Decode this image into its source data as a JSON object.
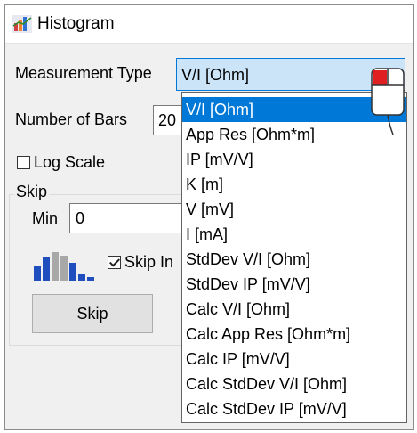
{
  "window": {
    "title": "Histogram",
    "icon": "histogram-app-icon"
  },
  "form": {
    "measurement_type_label": "Measurement Type",
    "measurement_type_value": "V/I [Ohm]",
    "number_of_bars_label": "Number of Bars",
    "number_of_bars_value": "20",
    "log_scale_label": "Log Scale",
    "log_scale_checked": false
  },
  "skip_group": {
    "legend": "Skip",
    "min_label": "Min",
    "min_value": "0",
    "skip_checkbox_label": "Skip In",
    "skip_checkbox_checked": true,
    "skip_button_label": "Skip"
  },
  "dropdown": {
    "selected_index": 0,
    "options": [
      "V/I [Ohm]",
      "App Res [Ohm*m]",
      "IP [mV/V]",
      "K [m]",
      "V [mV]",
      "I [mA]",
      "StdDev V/I [Ohm]",
      "StdDev IP [mV/V]",
      "Calc V/I [Ohm]",
      "Calc App Res [Ohm*m]",
      "Calc IP [mV/V]",
      "Calc StdDev V/I [Ohm]",
      "Calc StdDev IP [mV/V]"
    ]
  },
  "colors": {
    "accent": "#0078d7",
    "combo_bg": "#cce4f7",
    "window_bg": "#f0f0f0",
    "histogram_blue": "#1f4fbf",
    "histogram_gray": "#a8a8a8"
  },
  "icons": {
    "histogram_preview": "histogram-bars-icon",
    "mouse_cursor": "mouse-click-icon"
  }
}
